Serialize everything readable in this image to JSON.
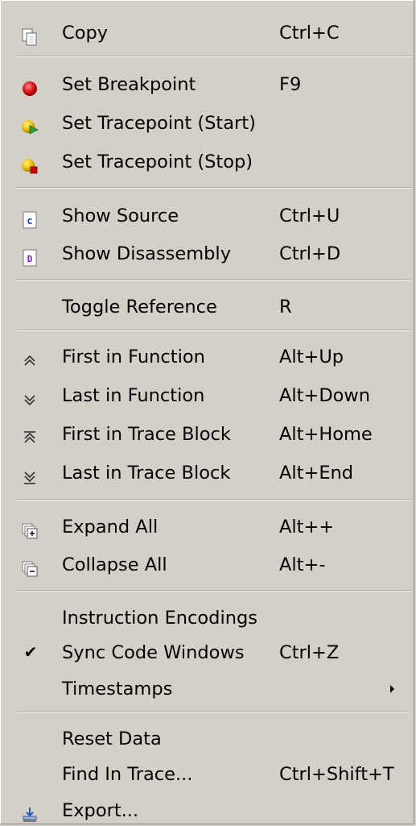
{
  "menu": {
    "items": {
      "copy": {
        "label": "Copy",
        "shortcut": "Ctrl+C",
        "icon": "copy-icon"
      },
      "set_breakpoint": {
        "label": "Set Breakpoint",
        "shortcut": "F9",
        "icon": "breakpoint-icon"
      },
      "set_tracepoint_start": {
        "label": "Set Tracepoint (Start)",
        "shortcut": "",
        "icon": "tracepoint-start-icon"
      },
      "set_tracepoint_stop": {
        "label": "Set Tracepoint (Stop)",
        "shortcut": "",
        "icon": "tracepoint-stop-icon"
      },
      "show_source": {
        "label": "Show Source",
        "shortcut": "Ctrl+U",
        "icon": "source-icon"
      },
      "show_disassembly": {
        "label": "Show Disassembly",
        "shortcut": "Ctrl+D",
        "icon": "disassembly-icon"
      },
      "toggle_reference": {
        "label": "Toggle Reference",
        "shortcut": "R",
        "icon": ""
      },
      "first_in_function": {
        "label": "First in Function",
        "shortcut": "Alt+Up",
        "icon": "double-chevron-up-icon"
      },
      "last_in_function": {
        "label": "Last in Function",
        "shortcut": "Alt+Down",
        "icon": "double-chevron-down-icon"
      },
      "first_in_trace_block": {
        "label": "First in Trace Block",
        "shortcut": "Alt+Home",
        "icon": "first-in-block-icon"
      },
      "last_in_trace_block": {
        "label": "Last in Trace Block",
        "shortcut": "Alt+End",
        "icon": "last-in-block-icon"
      },
      "expand_all": {
        "label": "Expand All",
        "shortcut": "Alt++",
        "icon": "expand-all-icon"
      },
      "collapse_all": {
        "label": "Collapse All",
        "shortcut": "Alt+-",
        "icon": "collapse-all-icon"
      },
      "instruction_encodings": {
        "label": "Instruction Encodings",
        "shortcut": "",
        "icon": ""
      },
      "sync_code_windows": {
        "label": "Sync Code Windows",
        "shortcut": "Ctrl+Z",
        "checked": true,
        "icon": "checkmark-icon"
      },
      "timestamps": {
        "label": "Timestamps",
        "shortcut": "",
        "has_submenu": true,
        "icon": "submenu-arrow-icon"
      },
      "reset_data": {
        "label": "Reset Data",
        "shortcut": "",
        "icon": ""
      },
      "find_in_trace": {
        "label": "Find In Trace...",
        "shortcut": "Ctrl+Shift+T",
        "icon": ""
      },
      "export": {
        "label": "Export...",
        "shortcut": "",
        "icon": "export-icon"
      }
    }
  },
  "colors": {
    "menu_background": "#d4d0c8",
    "breakpoint_red": "#cc1111",
    "tracepoint_yellow": "#f0c000",
    "tracepoint_green": "#2ea02e",
    "tracepoint_stop_red": "#d00000",
    "source_letter_blue": "#1a3cc8",
    "disassembly_letter_purple": "#8a1aa8"
  }
}
